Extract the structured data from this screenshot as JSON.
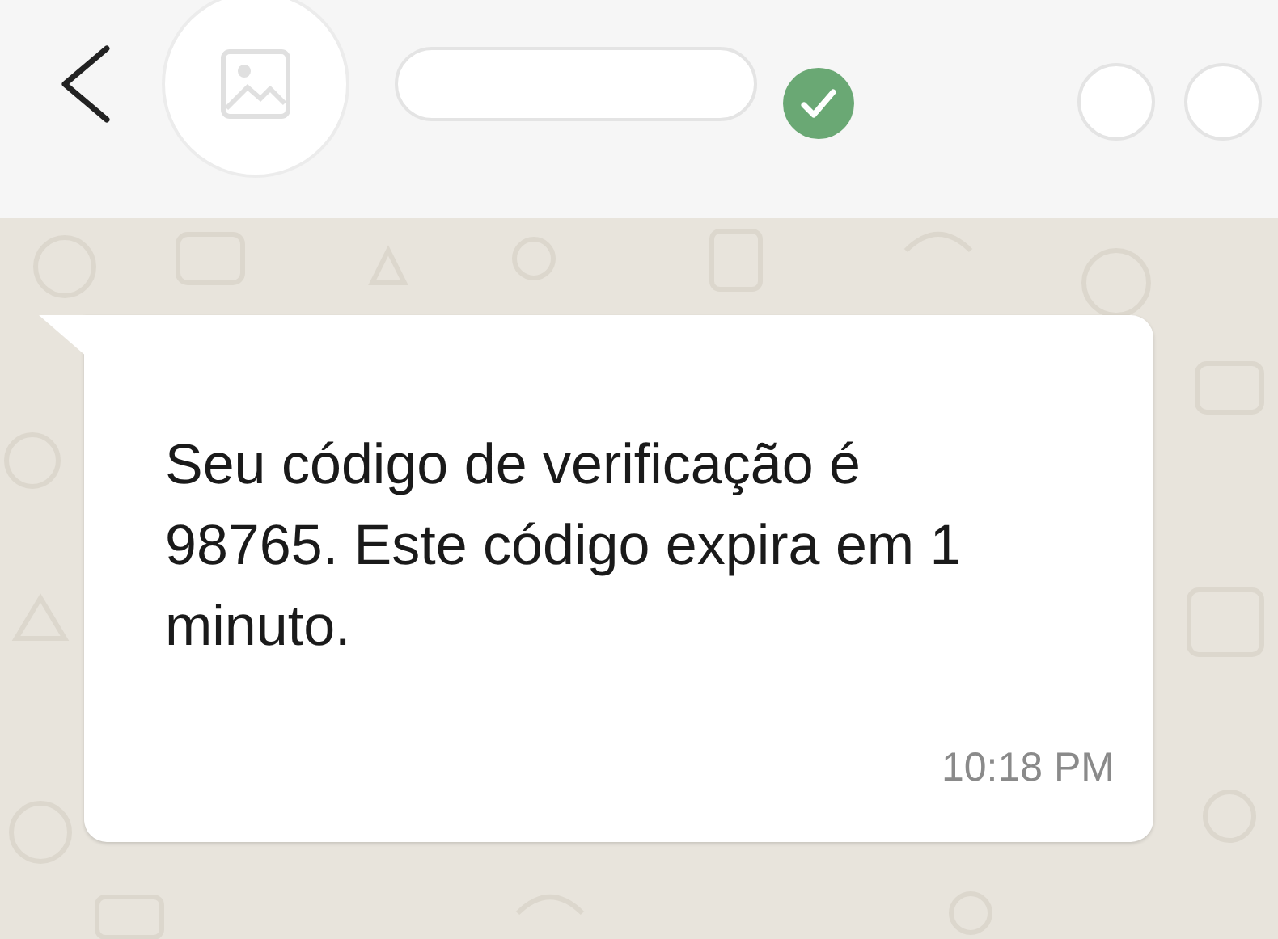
{
  "header": {
    "verified": true
  },
  "message": {
    "text": "Seu código de verificação é 98765. Este código expira em 1 minuto.",
    "time": "10:18 PM"
  }
}
